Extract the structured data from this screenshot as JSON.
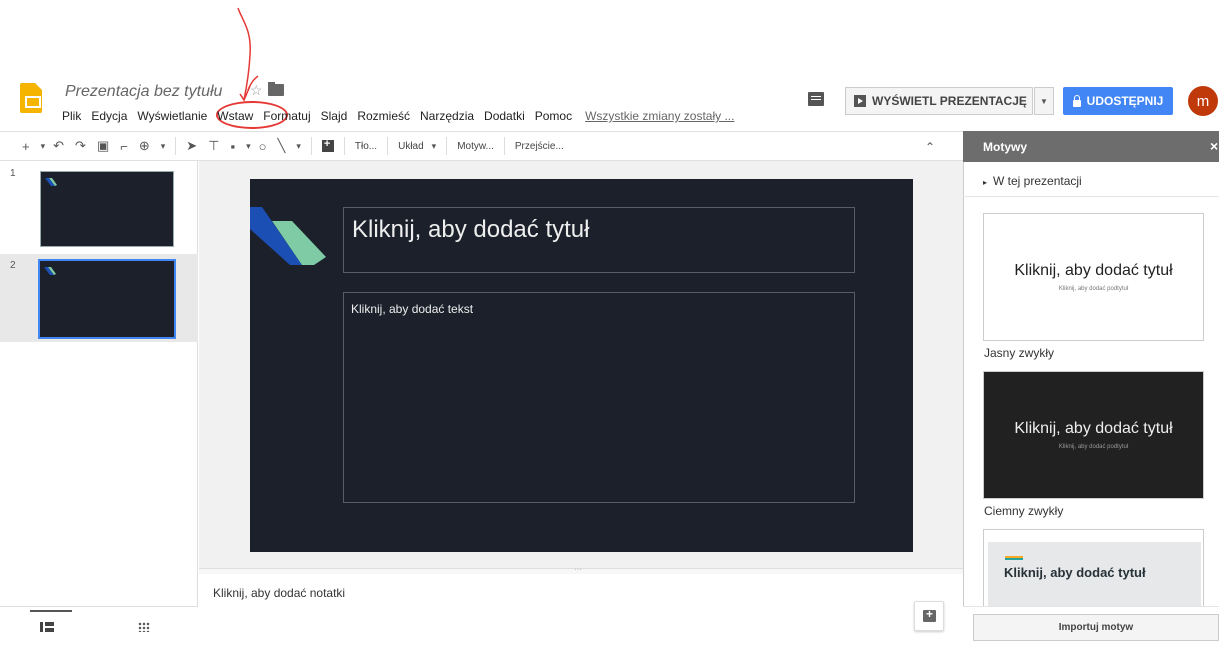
{
  "document": {
    "title": "Prezentacja bez tytułu"
  },
  "menu": {
    "items": [
      "Plik",
      "Edycja",
      "Wyświetlanie",
      "Wstaw",
      "Formatuj",
      "Slajd",
      "Rozmieść",
      "Narzędzia",
      "Dodatki",
      "Pomoc"
    ],
    "save_status": "Wszystkie zmiany zostały ..."
  },
  "header": {
    "present_label": "WYŚWIETL PREZENTACJĘ",
    "share_label": "UDOSTĘPNIJ",
    "avatar_initial": "m",
    "share_color": "#4285f4",
    "avatar_color": "#c0390b"
  },
  "toolbar": {
    "background_label": "Tło...",
    "layout_label": "Układ",
    "theme_label": "Motyw...",
    "transition_label": "Przejście..."
  },
  "filmstrip": {
    "slides": [
      {
        "number": "1"
      },
      {
        "number": "2",
        "selected": true
      }
    ]
  },
  "slide": {
    "title_placeholder": "Kliknij, aby dodać tytuł",
    "body_placeholder": "Kliknij, aby dodać tekst",
    "background_color": "#1b202b"
  },
  "notes": {
    "placeholder": "Kliknij, aby dodać notatki"
  },
  "themes_panel": {
    "title": "Motywy",
    "section": "W tej prezentacji",
    "themes": [
      {
        "name": "Jasny zwykły",
        "preview_title": "Kliknij, aby dodać tytuł",
        "preview_subtitle": "Kliknij, aby dodać podtytuł"
      },
      {
        "name": "Ciemny zwykły",
        "preview_title": "Kliknij, aby dodać tytuł",
        "preview_subtitle": "Kliknij, aby dodać podtytuł"
      },
      {
        "name": "",
        "preview_title": "Kliknij, aby dodać tytuł",
        "preview_subtitle": ""
      }
    ],
    "import_label": "Importuj motyw"
  }
}
